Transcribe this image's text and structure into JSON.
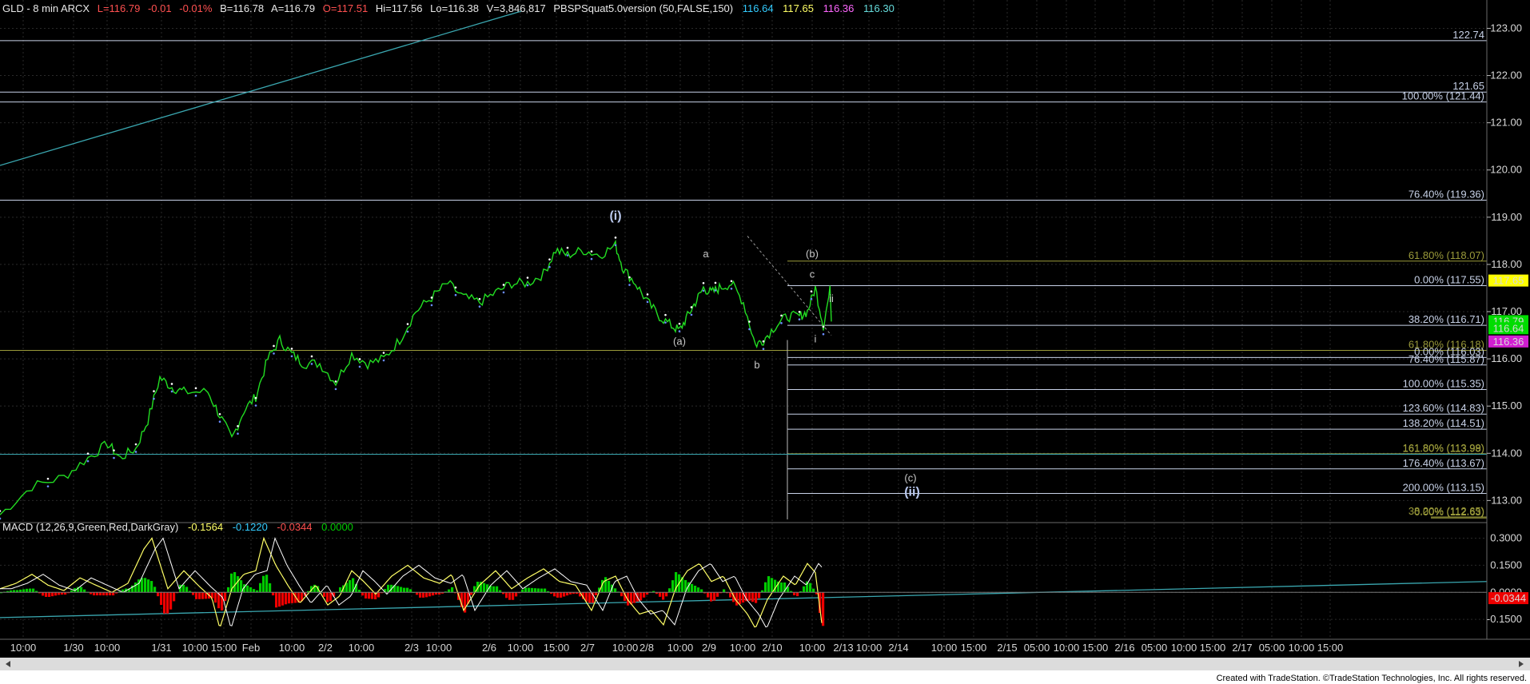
{
  "header": {
    "symbol": "GLD - 8 min ARCX",
    "last": "L=116.79",
    "change": "-0.01",
    "change_pct": "-0.01%",
    "bid": "B=116.78",
    "ask": "A=116.79",
    "open": "O=117.51",
    "high": "Hi=117.56",
    "low": "Lo=116.38",
    "volume": "V=3,846,817",
    "study": "PBSPSquat5.0version (50,FALSE,150)",
    "study_vals": [
      "116.64",
      "117.65",
      "116.36",
      "116.30"
    ]
  },
  "macd_header": {
    "name": "MACD (12,26,9,Green,Red,DarkGray)",
    "vals": [
      "-0.1564",
      "-0.1220",
      "-0.0344",
      "0.0000"
    ]
  },
  "footer": {
    "credit": "Created with TradeStation. ©TradeStation Technologies, Inc. All rights reserved."
  },
  "colors": {
    "price": "#22dd22",
    "macd_line": "#ffff66",
    "signal_line": "#ffffff",
    "hist_pos": "#00cc00",
    "hist_neg": "#ee0000",
    "trend": "#3aa7b0",
    "fib_line": "#c8d2e8",
    "fib_olive": "#9a9a3a",
    "badge_yellow": "#ffff00",
    "badge_green": "#00dd00",
    "badge_magenta": "#d21ed2"
  },
  "chart_data": [
    {
      "type": "line",
      "name": "GLD - 8 min ARCX",
      "x_ticks": [
        "10:00",
        "1/30",
        "10:00",
        "1/31",
        "10:00",
        "15:00",
        "Feb",
        "10:00",
        "2/2",
        "10:00",
        "2/3",
        "10:00",
        "2/6",
        "10:00",
        "15:00",
        "2/7",
        "10:00",
        "2/8",
        "10:00",
        "2/9",
        "10:00",
        "2/10",
        "10:00",
        "2/13",
        "10:00",
        "2/14",
        "10:00",
        "15:00",
        "2/15",
        "05:00",
        "10:00",
        "15:00",
        "2/16",
        "05:00",
        "10:00",
        "15:00",
        "2/17",
        "05:00",
        "10:00",
        "15:00"
      ],
      "y_ticks": [
        "123.00",
        "122.00",
        "121.00",
        "120.00",
        "119.00",
        "118.00",
        "117.00",
        "116.00",
        "115.00",
        "114.00",
        "113.00"
      ],
      "ylim": [
        112.6,
        123.6
      ],
      "price_path": [
        [
          0,
          112.7
        ],
        [
          40,
          113.3
        ],
        [
          80,
          113.5
        ],
        [
          110,
          113.9
        ],
        [
          135,
          114.2
        ],
        [
          150,
          113.9
        ],
        [
          170,
          114.1
        ],
        [
          185,
          114.7
        ],
        [
          200,
          115.6
        ],
        [
          215,
          115.4
        ],
        [
          230,
          115.3
        ],
        [
          260,
          115.3
        ],
        [
          275,
          114.8
        ],
        [
          290,
          114.3
        ],
        [
          305,
          114.9
        ],
        [
          320,
          115.2
        ],
        [
          335,
          116.0
        ],
        [
          350,
          116.4
        ],
        [
          365,
          116.1
        ],
        [
          380,
          115.9
        ],
        [
          400,
          115.9
        ],
        [
          420,
          115.5
        ],
        [
          440,
          116.1
        ],
        [
          460,
          115.9
        ],
        [
          480,
          116.0
        ],
        [
          500,
          116.4
        ],
        [
          520,
          117.0
        ],
        [
          540,
          117.3
        ],
        [
          560,
          117.6
        ],
        [
          580,
          117.3
        ],
        [
          600,
          117.2
        ],
        [
          620,
          117.4
        ],
        [
          640,
          117.6
        ],
        [
          660,
          117.6
        ],
        [
          680,
          117.8
        ],
        [
          695,
          118.3
        ],
        [
          710,
          118.2
        ],
        [
          730,
          118.3
        ],
        [
          750,
          118.2
        ],
        [
          770,
          118.4
        ],
        [
          780,
          117.9
        ],
        [
          795,
          117.6
        ],
        [
          810,
          117.2
        ],
        [
          825,
          116.9
        ],
        [
          840,
          116.7
        ],
        [
          850,
          116.6
        ],
        [
          860,
          116.9
        ],
        [
          870,
          117.2
        ],
        [
          880,
          117.5
        ],
        [
          890,
          117.4
        ],
        [
          900,
          117.5
        ],
        [
          915,
          117.6
        ],
        [
          930,
          117.2
        ],
        [
          945,
          116.3
        ],
        [
          955,
          116.4
        ],
        [
          970,
          116.7
        ],
        [
          985,
          116.9
        ],
        [
          1000,
          116.9
        ],
        [
          1010,
          117.0
        ],
        [
          1020,
          117.5
        ],
        [
          1030,
          116.7
        ],
        [
          1040,
          117.6
        ]
      ],
      "price_last": 116.79,
      "badges": [
        {
          "label": "117.65",
          "value": 117.65,
          "color": "#ffff00"
        },
        {
          "label": "116.79",
          "value": 116.79,
          "color": "#00dd00"
        },
        {
          "label": "116.64",
          "value": 116.64,
          "color": "#00dd00"
        },
        {
          "label": "116.36",
          "value": 116.36,
          "color": "#d21ed2"
        }
      ],
      "levels": [
        {
          "value": 122.74,
          "label": "122.74",
          "kind": "plain"
        },
        {
          "value": 121.65,
          "label": "121.65",
          "kind": "plain"
        },
        {
          "value": 121.44,
          "label": "100.00% (121.44)",
          "kind": "fib"
        },
        {
          "value": 119.36,
          "label": "76.40% (119.36)",
          "kind": "fib"
        },
        {
          "value": 118.07,
          "label": "61.80% (118.07)",
          "kind": "olive"
        },
        {
          "value": 117.55,
          "label": "0.00% (117.55)",
          "kind": "fib"
        },
        {
          "value": 116.71,
          "label": "38.20% (116.71)",
          "kind": "fib"
        },
        {
          "value": 116.18,
          "label": "61.80% (116.18)",
          "kind": "olive"
        },
        {
          "value": 116.03,
          "label": "0.00% (116.03)",
          "kind": "fib"
        },
        {
          "value": 115.87,
          "label": "76.40% (115.87)",
          "kind": "fib"
        },
        {
          "value": 115.35,
          "label": "100.00% (115.35)",
          "kind": "fib"
        },
        {
          "value": 114.83,
          "label": "123.60% (114.83)",
          "kind": "fib"
        },
        {
          "value": 114.51,
          "label": "138.20% (114.51)",
          "kind": "fib"
        },
        {
          "value": 113.99,
          "label": "161.80% (113.99)",
          "kind": "olive"
        },
        {
          "value": 113.98,
          "label": "161.80% (113.98)",
          "kind": "olive"
        },
        {
          "value": 113.67,
          "label": "176.40% (113.67)",
          "kind": "fib"
        },
        {
          "value": 113.15,
          "label": "200.00% (113.15)",
          "kind": "fib"
        },
        {
          "value": 112.65,
          "label": "38.20% (112.65)",
          "kind": "olive"
        },
        {
          "value": 112.63,
          "label": "0.00% (112.63)",
          "kind": "olive"
        }
      ],
      "wave_labels": [
        {
          "label": "(i)",
          "x": 770,
          "y": 118.95,
          "big": true
        },
        {
          "label": "a",
          "x": 883,
          "y": 118.15,
          "big": false
        },
        {
          "label": "(b)",
          "x": 1016,
          "y": 118.15,
          "big": false
        },
        {
          "label": "c",
          "x": 1016,
          "y": 117.72,
          "big": false
        },
        {
          "label": "ii",
          "x": 1040,
          "y": 117.2,
          "big": false
        },
        {
          "label": "i",
          "x": 1020,
          "y": 116.35,
          "big": false
        },
        {
          "label": "(a)",
          "x": 850,
          "y": 116.3,
          "big": false
        },
        {
          "label": "b",
          "x": 947,
          "y": 115.8,
          "big": false
        },
        {
          "label": "(c)",
          "x": 1139,
          "y": 113.4,
          "big": false
        },
        {
          "label": "(ii)",
          "x": 1141,
          "y": 113.1,
          "big": true
        }
      ]
    },
    {
      "type": "line",
      "name": "MACD (12,26,9,Green,Red,DarkGray)",
      "y_ticks": [
        "0.3000",
        "0.1500",
        "0.0000",
        "-0.1500"
      ],
      "ylim": [
        -0.26,
        0.36
      ],
      "current_badge": "-0.0344",
      "macd_path": [
        [
          0,
          0.02
        ],
        [
          20,
          0.05
        ],
        [
          40,
          0.1
        ],
        [
          60,
          0.04
        ],
        [
          80,
          0.01
        ],
        [
          100,
          0.08
        ],
        [
          120,
          0.04
        ],
        [
          140,
          0.0
        ],
        [
          160,
          0.05
        ],
        [
          180,
          0.24
        ],
        [
          190,
          0.3
        ],
        [
          200,
          0.16
        ],
        [
          210,
          0.02
        ],
        [
          230,
          0.12
        ],
        [
          250,
          0.03
        ],
        [
          265,
          -0.03
        ],
        [
          275,
          -0.2
        ],
        [
          290,
          0.02
        ],
        [
          305,
          0.1
        ],
        [
          320,
          0.12
        ],
        [
          330,
          0.3
        ],
        [
          345,
          0.15
        ],
        [
          360,
          0.04
        ],
        [
          375,
          -0.06
        ],
        [
          395,
          0.04
        ],
        [
          410,
          -0.07
        ],
        [
          425,
          -0.02
        ],
        [
          440,
          0.12
        ],
        [
          455,
          0.06
        ],
        [
          470,
          -0.01
        ],
        [
          490,
          0.09
        ],
        [
          510,
          0.15
        ],
        [
          530,
          0.08
        ],
        [
          550,
          0.05
        ],
        [
          565,
          0.1
        ],
        [
          580,
          -0.1
        ],
        [
          600,
          0.04
        ],
        [
          620,
          0.12
        ],
        [
          640,
          0.02
        ],
        [
          660,
          0.08
        ],
        [
          680,
          0.13
        ],
        [
          700,
          0.06
        ],
        [
          720,
          0.04
        ],
        [
          740,
          -0.1
        ],
        [
          755,
          0.06
        ],
        [
          770,
          0.09
        ],
        [
          785,
          -0.04
        ],
        [
          800,
          -0.12
        ],
        [
          815,
          -0.1
        ],
        [
          830,
          -0.18
        ],
        [
          845,
          0.02
        ],
        [
          860,
          0.12
        ],
        [
          875,
          0.16
        ],
        [
          890,
          0.06
        ],
        [
          905,
          0.09
        ],
        [
          920,
          -0.04
        ],
        [
          935,
          -0.12
        ],
        [
          945,
          -0.2
        ],
        [
          960,
          -0.04
        ],
        [
          980,
          0.09
        ],
        [
          995,
          0.04
        ],
        [
          1010,
          0.16
        ],
        [
          1020,
          0.11
        ],
        [
          1028,
          -0.17
        ]
      ],
      "trend_start": -0.14,
      "trend_end": 0.06
    }
  ]
}
